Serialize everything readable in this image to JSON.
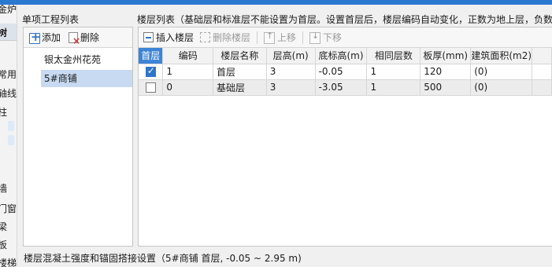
{
  "left_strip": {
    "texts": [
      "金炉",
      "树",
      "常用",
      "轴线",
      "柱",
      "墙",
      "门窗",
      "梁",
      "板",
      "楼梯"
    ]
  },
  "project_panel": {
    "title": "单项工程列表",
    "add_label": "添加",
    "delete_label": "删除",
    "items": [
      "银太金州花苑",
      "5#商铺"
    ],
    "selected": "5#商铺"
  },
  "floor_panel": {
    "title": "楼层列表（基础层和标准层不能设置为首层。设置首层后，楼层编码自动变化，正数为地上层，负数",
    "toolbar": {
      "insert_label": "插入楼层",
      "remove_label": "删除楼层",
      "up_label": "上移",
      "down_label": "下移"
    },
    "columns": [
      "首层",
      "编码",
      "楼层名称",
      "层高(m)",
      "底标高(m)",
      "相同层数",
      "板厚(mm)",
      "建筑面积(m2)"
    ],
    "rows": [
      {
        "first": true,
        "code": "1",
        "name": "首层",
        "height": "3",
        "bottom": "-0.05",
        "same": "1",
        "slab": "120",
        "area": "(0)"
      },
      {
        "first": false,
        "code": "0",
        "name": "基础层",
        "height": "3",
        "bottom": "-3.05",
        "same": "1",
        "slab": "500",
        "area": "(0)"
      }
    ]
  },
  "status_text": "楼层混凝土强度和锚固搭接设置（5#商铺  首层, -0.05 ~ 2.95 m)"
}
